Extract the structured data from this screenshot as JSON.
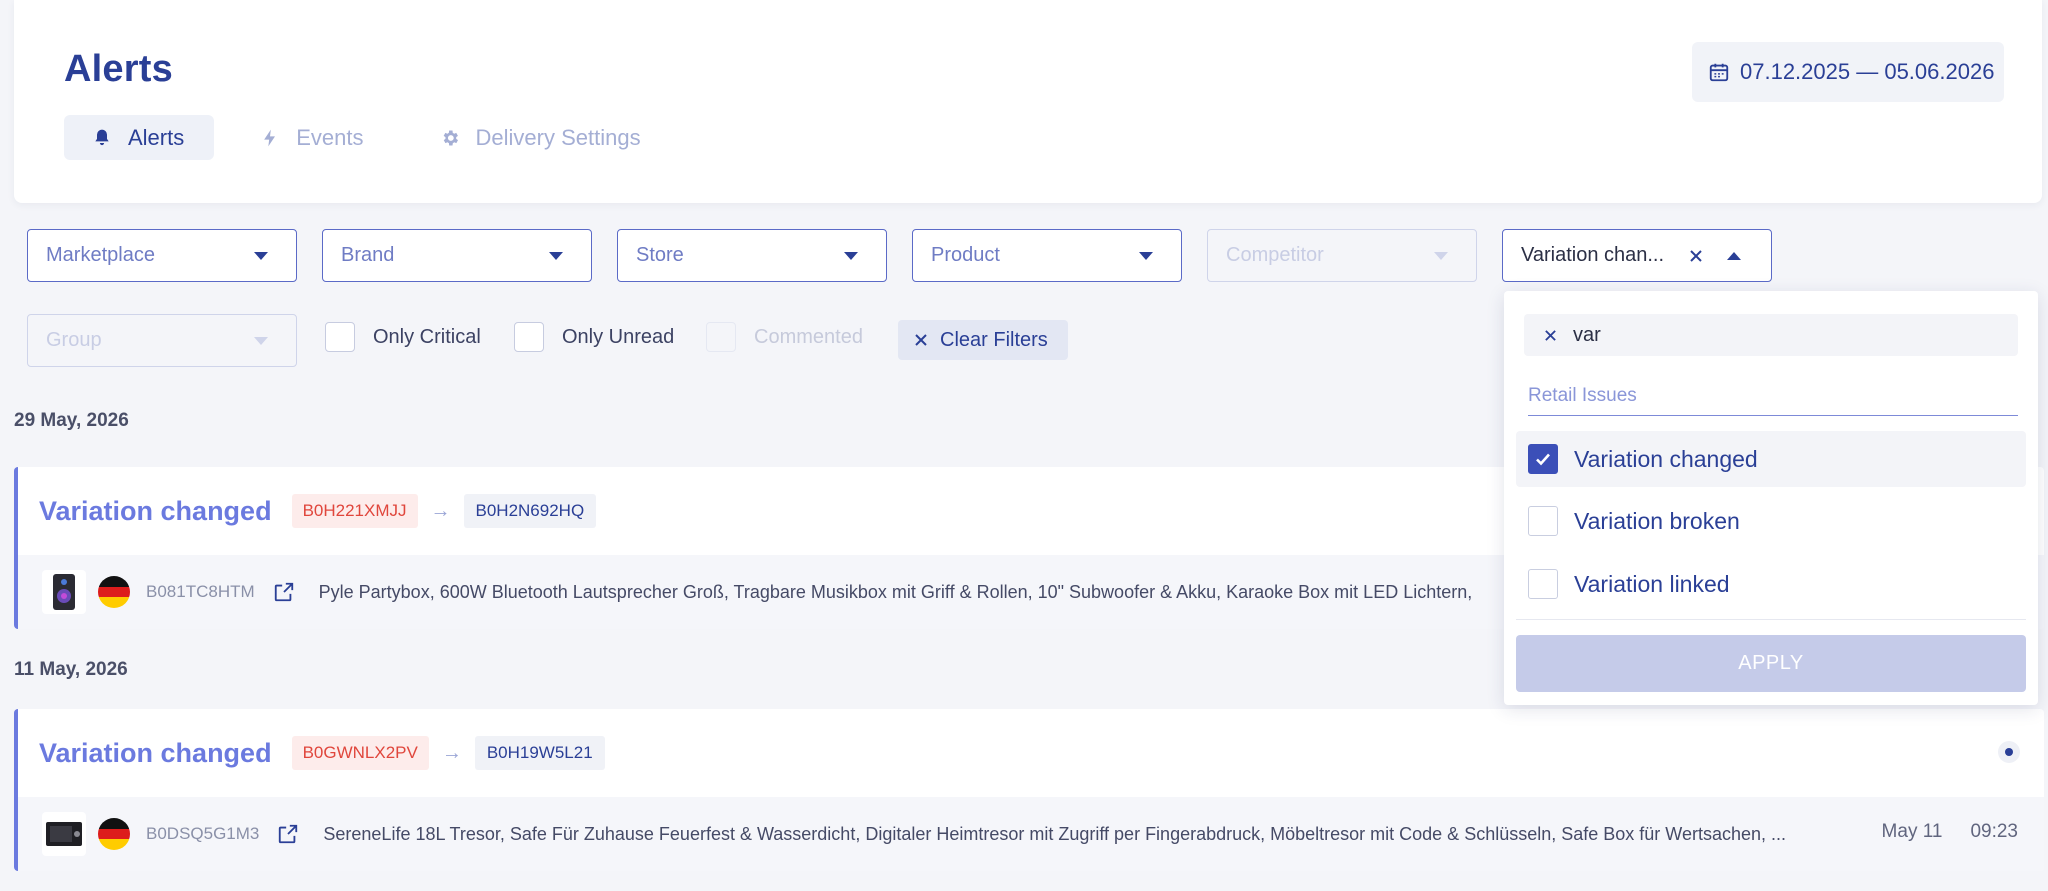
{
  "header": {
    "title": "Alerts",
    "date_range": "07.12.2025 — 05.06.2026",
    "tabs": [
      {
        "label": "Alerts",
        "icon": "bell-icon",
        "active": true
      },
      {
        "label": "Events",
        "icon": "bolt-icon",
        "active": false
      },
      {
        "label": "Delivery Settings",
        "icon": "gear-icon",
        "active": false
      }
    ]
  },
  "filters": {
    "marketplace": "Marketplace",
    "brand": "Brand",
    "store": "Store",
    "product": "Product",
    "competitor": "Competitor",
    "alert_type_value": "Variation chan...",
    "group": "Group",
    "only_critical": "Only Critical",
    "only_unread": "Only Unread",
    "commented": "Commented",
    "clear": "Clear Filters"
  },
  "dropdown": {
    "search_value": "var",
    "group_label": "Retail Issues",
    "options": [
      {
        "label": "Variation changed",
        "checked": true
      },
      {
        "label": "Variation broken",
        "checked": false
      },
      {
        "label": "Variation linked",
        "checked": false
      }
    ],
    "apply": "APPLY"
  },
  "groups": [
    {
      "date": "29 May, 2026",
      "alert": {
        "title": "Variation changed",
        "from_asin": "B0H221XMJJ",
        "to_asin": "B0H2N692HQ",
        "sku": "B081TC8HTM",
        "product": "Pyle Partybox, 600W Bluetooth Lautsprecher Groß, Tragbare Musikbox mit Griff & Rollen, 10\" Subwoofer & Akku, Karaoke Box mit LED Lichtern,"
      }
    },
    {
      "date": "11 May, 2026",
      "alert": {
        "title": "Variation changed",
        "from_asin": "B0GWNLX2PV",
        "to_asin": "B0H19W5L21",
        "sku": "B0DSQ5G1M3",
        "product": "SereneLife 18L Tresor, Safe Für Zuhause Feuerfest & Wasserdicht, Digitaler Heimtresor mit Zugriff per Fingerabdruck, Möbeltresor mit Code & Schlüsseln, Safe Box für Wertsachen, ...",
        "date": "May 11",
        "time": "09:23"
      }
    }
  ],
  "colors": {
    "primary": "#2a3f96",
    "accent": "#6b7adf",
    "danger": "#e0463c"
  }
}
